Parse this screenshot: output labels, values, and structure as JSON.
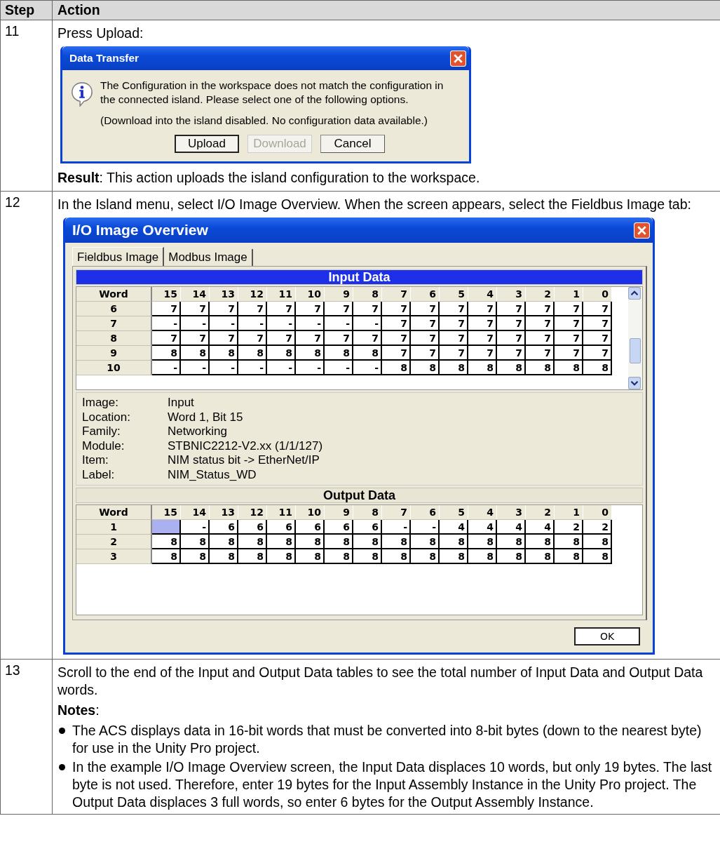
{
  "table": {
    "columns": [
      "Step",
      "Action"
    ],
    "rows": [
      {
        "step": "11",
        "kind": "dialog",
        "intro": "Press Upload:",
        "dialog": {
          "title": "Data Transfer",
          "message": "The Configuration in the workspace does not match the configuration in the connected island. Please select one of the following options.",
          "note": "(Download into the island disabled. No configuration data available.)",
          "buttons": [
            {
              "label": "Upload",
              "disabled": false,
              "focused": true
            },
            {
              "label": "Download",
              "disabled": true,
              "focused": false
            },
            {
              "label": "Cancel",
              "disabled": false,
              "focused": false
            }
          ]
        },
        "result": "**Result**: This action uploads the island configuration to the workspace."
      },
      {
        "step": "12",
        "kind": "window",
        "intro": "In the Island menu, select I/O Image Overview. When the screen appears, select the Fieldbus Image tab:",
        "window": {
          "title": "I/O Image Overview",
          "tabs": [
            {
              "label": "Fieldbus Image",
              "selected": true
            },
            {
              "label": "Modbus Image",
              "selected": false
            }
          ],
          "input_data": {
            "title": "Input Data",
            "columns": [
              "Word",
              "15",
              "14",
              "13",
              "12",
              "11",
              "10",
              "9",
              "8",
              "7",
              "6",
              "5",
              "4",
              "3",
              "2",
              "1",
              "0"
            ],
            "rows": [
              [
                "6",
                "7",
                "7",
                "7",
                "7",
                "7",
                "7",
                "7",
                "7",
                "7",
                "7",
                "7",
                "7",
                "7",
                "7",
                "7",
                "7"
              ],
              [
                "7",
                "-",
                "-",
                "-",
                "-",
                "-",
                "-",
                "-",
                "-",
                "7",
                "7",
                "7",
                "7",
                "7",
                "7",
                "7",
                "7"
              ],
              [
                "8",
                "7",
                "7",
                "7",
                "7",
                "7",
                "7",
                "7",
                "7",
                "7",
                "7",
                "7",
                "7",
                "7",
                "7",
                "7",
                "7"
              ],
              [
                "9",
                "8",
                "8",
                "8",
                "8",
                "8",
                "8",
                "8",
                "8",
                "7",
                "7",
                "7",
                "7",
                "7",
                "7",
                "7",
                "7"
              ],
              [
                "10",
                "-",
                "-",
                "-",
                "-",
                "-",
                "-",
                "-",
                "-",
                "8",
                "8",
                "8",
                "8",
                "8",
                "8",
                "8",
                "8"
              ]
            ]
          },
          "details": [
            {
              "label": "Image:",
              "value": "Input"
            },
            {
              "label": "Location:",
              "value": "Word 1, Bit 15"
            },
            {
              "label": "Family:",
              "value": "Networking"
            },
            {
              "label": "Module:",
              "value": "STBNIC2212-V2.xx (1/1/127)"
            },
            {
              "label": "Item:",
              "value": "NIM status bit -> EtherNet/IP"
            },
            {
              "label": "Label:",
              "value": "NIM_Status_WD"
            }
          ],
          "output_data": {
            "title": "Output Data",
            "columns": [
              "Word",
              "15",
              "14",
              "13",
              "12",
              "11",
              "10",
              "9",
              "8",
              "7",
              "6",
              "5",
              "4",
              "3",
              "2",
              "1",
              "0"
            ],
            "rows": [
              [
                "1",
                {
                  "selected": true
                },
                "-",
                "6",
                "6",
                "6",
                "6",
                "6",
                "6",
                "-",
                "-",
                "4",
                "4",
                "4",
                "4",
                "2",
                "2"
              ],
              [
                "2",
                "8",
                "8",
                "8",
                "8",
                "8",
                "8",
                "8",
                "8",
                "8",
                "8",
                "8",
                "8",
                "8",
                "8",
                "8",
                "8"
              ],
              [
                "3",
                "8",
                "8",
                "8",
                "8",
                "8",
                "8",
                "8",
                "8",
                "8",
                "8",
                "8",
                "8",
                "8",
                "8",
                "8",
                "8"
              ]
            ]
          },
          "ok_button": "OK"
        }
      },
      {
        "step": "13",
        "kind": "notes",
        "intro": "Scroll to the end of the Input and Output Data tables to see the total number of Input Data and Output Data words.",
        "notes_heading": "**Notes**:",
        "bullets": [
          "The ACS displays data in 16-bit words that must be converted into 8-bit bytes (down to the nearest byte) for use in the Unity Pro project.",
          "In the example I/O Image Overview screen, the Input Data displaces 10 words, but only 19 bytes. The last byte is not used. Therefore, enter 19 bytes for the Input Assembly Instance in the Unity Pro project. The Output Data displaces 3 full words, so enter 6 bytes for the Output Assembly Instance."
        ]
      }
    ]
  }
}
